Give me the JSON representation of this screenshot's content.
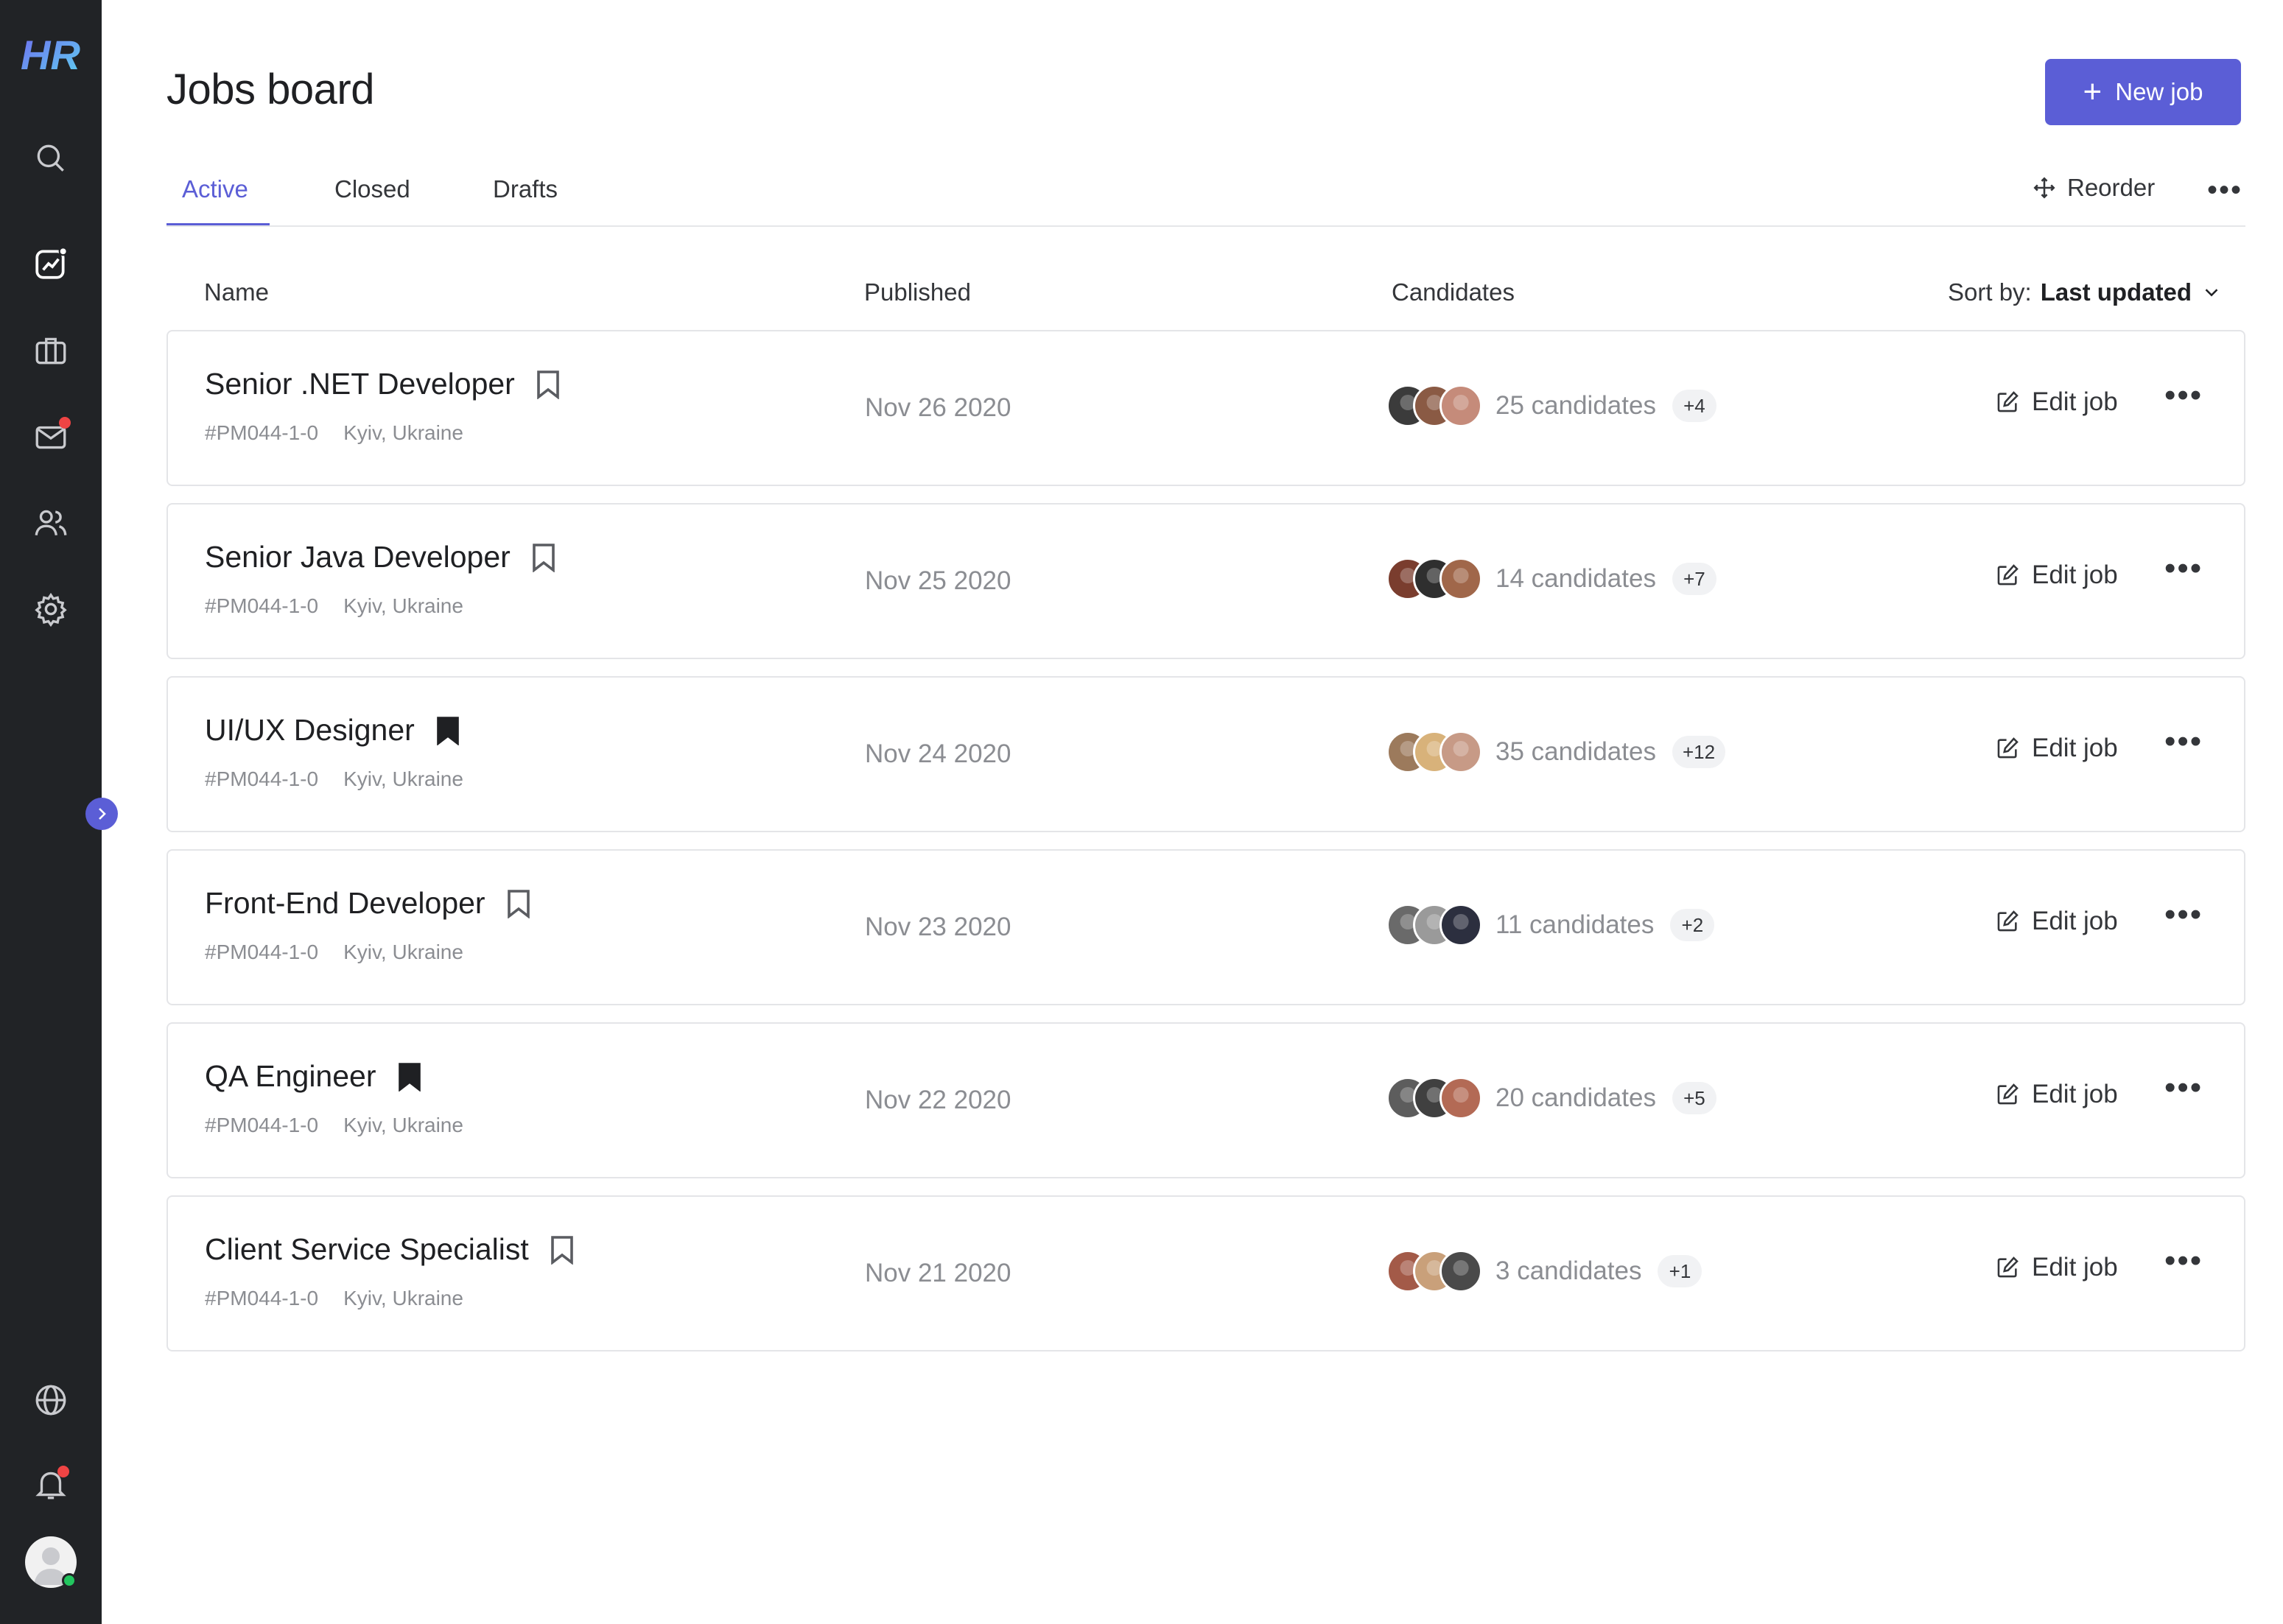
{
  "sidebar": {
    "logo_text": "HR",
    "icons": [
      "search-icon",
      "analytics-icon",
      "briefcase-icon",
      "mail-icon",
      "users-icon",
      "settings-icon",
      "globe-icon",
      "bell-icon"
    ]
  },
  "header": {
    "title": "Jobs board",
    "new_job_label": "New job"
  },
  "tabs": [
    {
      "label": "Active",
      "active": true
    },
    {
      "label": "Closed",
      "active": false
    },
    {
      "label": "Drafts",
      "active": false
    }
  ],
  "toolbar": {
    "reorder_label": "Reorder",
    "more_label": "•••"
  },
  "columns": {
    "name": "Name",
    "published": "Published",
    "candidates": "Candidates",
    "sort_prefix": "Sort by:",
    "sort_value": "Last updated"
  },
  "jobs": [
    {
      "title": "Senior .NET Developer",
      "bookmarked": false,
      "code": "#PM044-1-0",
      "location": "Kyiv, Ukraine",
      "published": "Nov 26 2020",
      "candidates": "25 candidates",
      "extra": "+4",
      "avatar_colors": [
        "#3b3b3b",
        "#8a5a44",
        "#c58b7a"
      ]
    },
    {
      "title": "Senior Java Developer",
      "bookmarked": false,
      "code": "#PM044-1-0",
      "location": "Kyiv, Ukraine",
      "published": "Nov 25 2020",
      "candidates": "14 candidates",
      "extra": "+7",
      "avatar_colors": [
        "#7a3d2e",
        "#2f2f2f",
        "#a0674a"
      ]
    },
    {
      "title": "UI/UX Designer",
      "bookmarked": true,
      "code": "#PM044-1-0",
      "location": "Kyiv, Ukraine",
      "published": "Nov 24 2020",
      "candidates": "35 candidates",
      "extra": "+12",
      "avatar_colors": [
        "#9c7a5c",
        "#d8b27a",
        "#c79a86"
      ]
    },
    {
      "title": "Front-End Developer",
      "bookmarked": false,
      "code": "#PM044-1-0",
      "location": "Kyiv, Ukraine",
      "published": "Nov 23 2020",
      "candidates": "11 candidates",
      "extra": "+2",
      "avatar_colors": [
        "#6a6a6a",
        "#9a9a9a",
        "#2c2f3f"
      ]
    },
    {
      "title": "QA Engineer",
      "bookmarked": true,
      "code": "#PM044-1-0",
      "location": "Kyiv, Ukraine",
      "published": "Nov 22 2020",
      "candidates": "20 candidates",
      "extra": "+5",
      "avatar_colors": [
        "#5d5d5d",
        "#404040",
        "#b36a55"
      ]
    },
    {
      "title": "Client Service Specialist",
      "bookmarked": false,
      "code": "#PM044-1-0",
      "location": "Kyiv, Ukraine",
      "published": "Nov 21 2020",
      "candidates": "3 candidates",
      "extra": "+1",
      "avatar_colors": [
        "#a35a48",
        "#c9a07a",
        "#4a4a4a"
      ]
    }
  ],
  "row_actions": {
    "edit_label": "Edit job",
    "more_label": "•••"
  },
  "colors": {
    "accent": "#5b5ed6",
    "sidebar_bg": "#212326",
    "notification": "#ef4444",
    "online": "#22c55e"
  }
}
